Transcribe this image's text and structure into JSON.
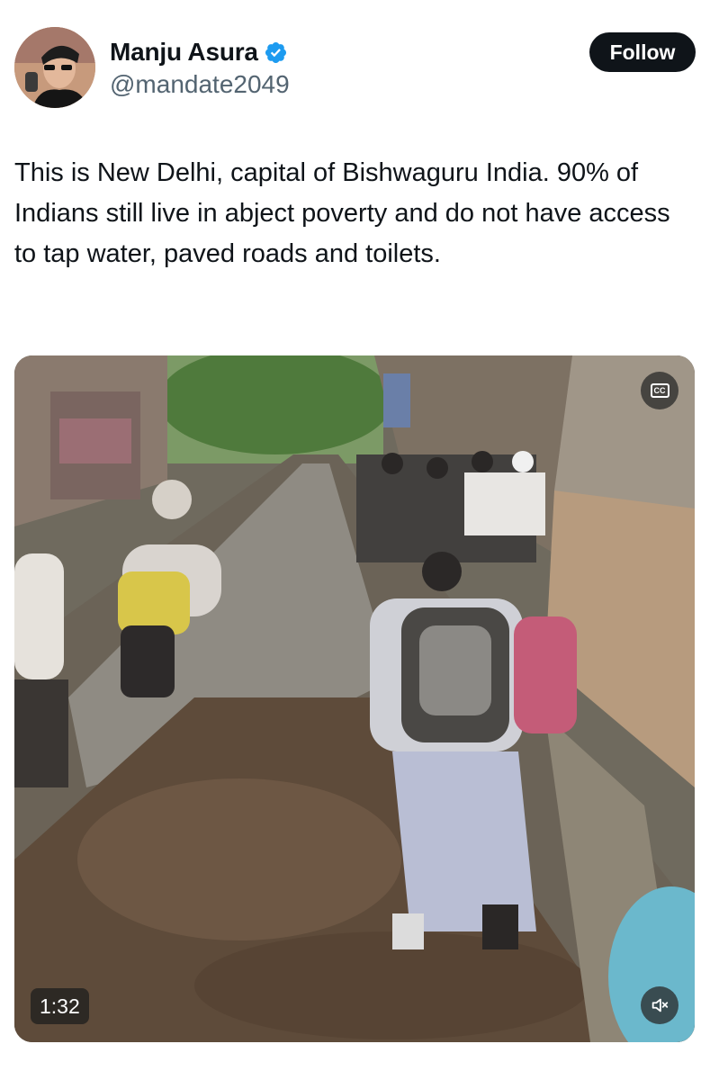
{
  "author": {
    "display_name": "Manju Asura",
    "handle": "@mandate2049",
    "verified": true,
    "verified_icon": "verified-badge-icon",
    "verified_color": "#1d9bf0"
  },
  "actions": {
    "follow_label": "Follow"
  },
  "tweet": {
    "text": "This is New Delhi, capital of Bishwaguru India. 90% of Indians still live in abject poverty and do not have access to tap water, paved roads and toilets."
  },
  "media": {
    "type": "video",
    "duration": "1:32",
    "cc_icon": "closed-captions-icon",
    "cc_label": "CC",
    "mute_icon": "muted-speaker-icon"
  },
  "colors": {
    "text_primary": "#0f1419",
    "text_secondary": "#536471",
    "follow_bg": "#0f1419",
    "follow_text": "#ffffff"
  }
}
